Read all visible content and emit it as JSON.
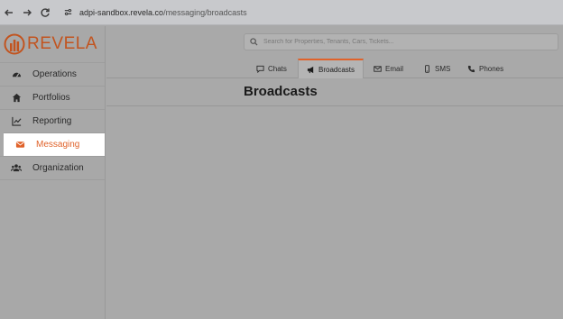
{
  "browser": {
    "url_host": "adpi-sandbox.revela.co",
    "url_path": "/messaging/broadcasts"
  },
  "logo": {
    "text": "REVELA"
  },
  "sidebar": {
    "items": [
      {
        "label": "Operations",
        "icon": "dashboard-icon"
      },
      {
        "label": "Portfolios",
        "icon": "home-icon"
      },
      {
        "label": "Reporting",
        "icon": "line-chart-icon"
      },
      {
        "label": "Messaging",
        "icon": "envelope-icon",
        "active": true
      },
      {
        "label": "Organization",
        "icon": "users-icon"
      }
    ]
  },
  "search": {
    "placeholder": "Search for Properties, Tenants, Cars, Tickets..."
  },
  "tabs": [
    {
      "label": "Chats",
      "icon": "chat-icon"
    },
    {
      "label": "Broadcasts",
      "icon": "megaphone-icon",
      "active": true
    },
    {
      "label": "Email",
      "icon": "envelope-icon"
    },
    {
      "label": "SMS",
      "icon": "phone-mobile-icon"
    },
    {
      "label": "Phones",
      "icon": "phone-icon"
    }
  ],
  "page": {
    "title": "Broadcasts"
  },
  "colors": {
    "accent": "#e0622a",
    "brand": "#c2541f"
  }
}
